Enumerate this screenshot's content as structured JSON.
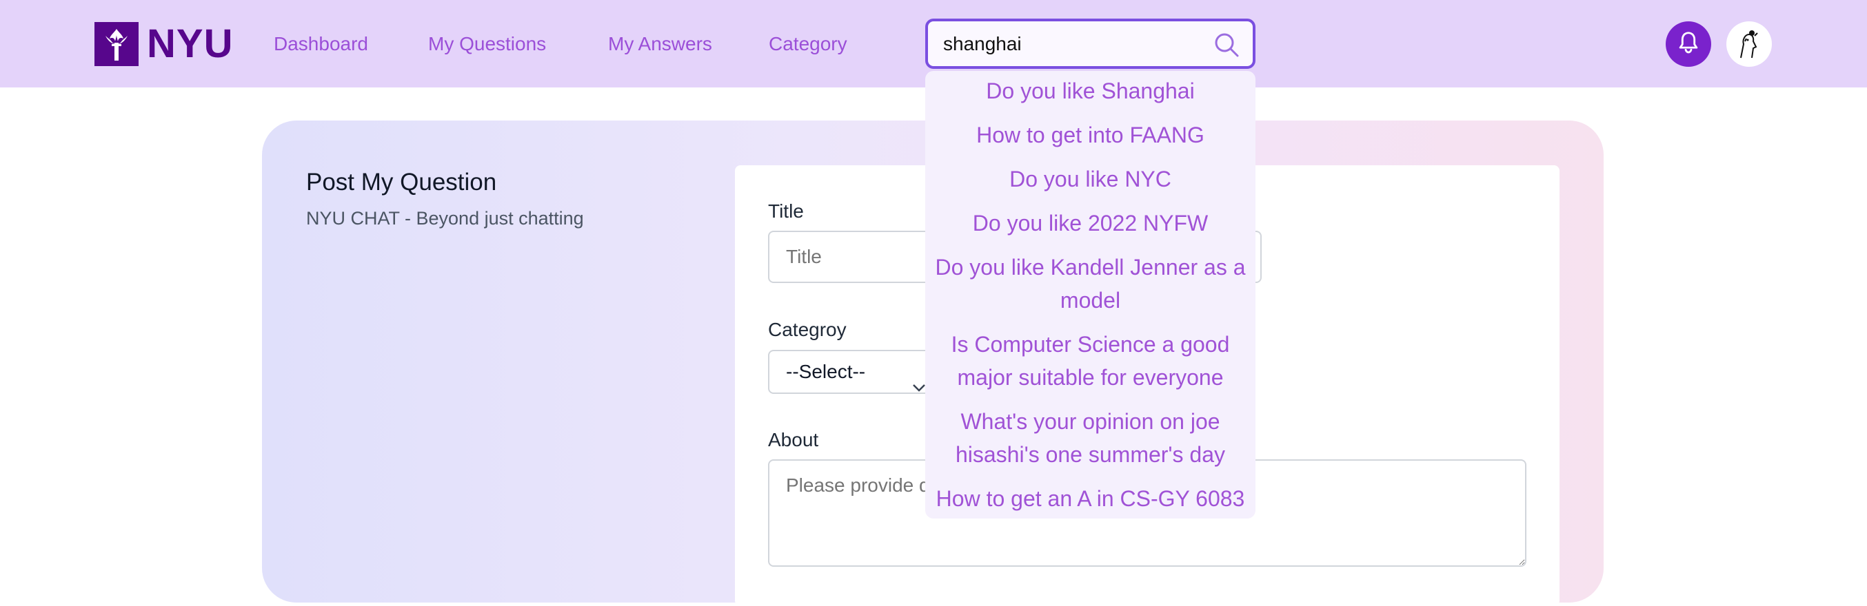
{
  "header": {
    "logo_text": "NYU",
    "nav": [
      "Dashboard",
      "My Questions",
      "My Answers",
      "Category"
    ],
    "search": {
      "value": "shanghai"
    },
    "accent_color": "#9b4fd8",
    "brand_color": "#57068c"
  },
  "suggestions": [
    "Do you like Shanghai",
    "How to get into FAANG",
    "Do you like NYC",
    "Do you like 2022 NYFW",
    "Do you like Kandell Jenner as a model",
    "Is Computer Science a good major suitable for everyone",
    "What's your opinion on joe hisashi's one summer's day",
    "How to get an A in CS-GY 6083"
  ],
  "main": {
    "title": "Post My Question",
    "subtitle": "NYU CHAT - Beyond just chatting"
  },
  "form": {
    "title_label": "Title",
    "title_placeholder": "Title",
    "category_label": "Categroy",
    "category_selected": "--Select--",
    "about_label": "About",
    "about_placeholder": "Please provide details"
  }
}
